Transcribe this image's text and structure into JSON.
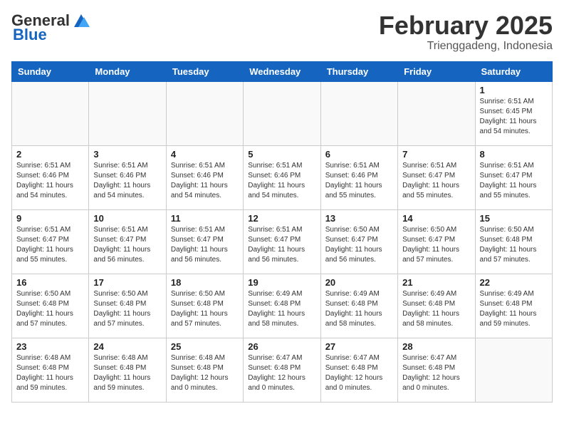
{
  "logo": {
    "text_general": "General",
    "text_blue": "Blue"
  },
  "header": {
    "month": "February 2025",
    "location": "Trienggadeng, Indonesia"
  },
  "weekdays": [
    "Sunday",
    "Monday",
    "Tuesday",
    "Wednesday",
    "Thursday",
    "Friday",
    "Saturday"
  ],
  "weeks": [
    [
      {
        "day": "",
        "info": ""
      },
      {
        "day": "",
        "info": ""
      },
      {
        "day": "",
        "info": ""
      },
      {
        "day": "",
        "info": ""
      },
      {
        "day": "",
        "info": ""
      },
      {
        "day": "",
        "info": ""
      },
      {
        "day": "1",
        "info": "Sunrise: 6:51 AM\nSunset: 6:45 PM\nDaylight: 11 hours\nand 54 minutes."
      }
    ],
    [
      {
        "day": "2",
        "info": "Sunrise: 6:51 AM\nSunset: 6:46 PM\nDaylight: 11 hours\nand 54 minutes."
      },
      {
        "day": "3",
        "info": "Sunrise: 6:51 AM\nSunset: 6:46 PM\nDaylight: 11 hours\nand 54 minutes."
      },
      {
        "day": "4",
        "info": "Sunrise: 6:51 AM\nSunset: 6:46 PM\nDaylight: 11 hours\nand 54 minutes."
      },
      {
        "day": "5",
        "info": "Sunrise: 6:51 AM\nSunset: 6:46 PM\nDaylight: 11 hours\nand 54 minutes."
      },
      {
        "day": "6",
        "info": "Sunrise: 6:51 AM\nSunset: 6:46 PM\nDaylight: 11 hours\nand 55 minutes."
      },
      {
        "day": "7",
        "info": "Sunrise: 6:51 AM\nSunset: 6:47 PM\nDaylight: 11 hours\nand 55 minutes."
      },
      {
        "day": "8",
        "info": "Sunrise: 6:51 AM\nSunset: 6:47 PM\nDaylight: 11 hours\nand 55 minutes."
      }
    ],
    [
      {
        "day": "9",
        "info": "Sunrise: 6:51 AM\nSunset: 6:47 PM\nDaylight: 11 hours\nand 55 minutes."
      },
      {
        "day": "10",
        "info": "Sunrise: 6:51 AM\nSunset: 6:47 PM\nDaylight: 11 hours\nand 56 minutes."
      },
      {
        "day": "11",
        "info": "Sunrise: 6:51 AM\nSunset: 6:47 PM\nDaylight: 11 hours\nand 56 minutes."
      },
      {
        "day": "12",
        "info": "Sunrise: 6:51 AM\nSunset: 6:47 PM\nDaylight: 11 hours\nand 56 minutes."
      },
      {
        "day": "13",
        "info": "Sunrise: 6:50 AM\nSunset: 6:47 PM\nDaylight: 11 hours\nand 56 minutes."
      },
      {
        "day": "14",
        "info": "Sunrise: 6:50 AM\nSunset: 6:47 PM\nDaylight: 11 hours\nand 57 minutes."
      },
      {
        "day": "15",
        "info": "Sunrise: 6:50 AM\nSunset: 6:48 PM\nDaylight: 11 hours\nand 57 minutes."
      }
    ],
    [
      {
        "day": "16",
        "info": "Sunrise: 6:50 AM\nSunset: 6:48 PM\nDaylight: 11 hours\nand 57 minutes."
      },
      {
        "day": "17",
        "info": "Sunrise: 6:50 AM\nSunset: 6:48 PM\nDaylight: 11 hours\nand 57 minutes."
      },
      {
        "day": "18",
        "info": "Sunrise: 6:50 AM\nSunset: 6:48 PM\nDaylight: 11 hours\nand 57 minutes."
      },
      {
        "day": "19",
        "info": "Sunrise: 6:49 AM\nSunset: 6:48 PM\nDaylight: 11 hours\nand 58 minutes."
      },
      {
        "day": "20",
        "info": "Sunrise: 6:49 AM\nSunset: 6:48 PM\nDaylight: 11 hours\nand 58 minutes."
      },
      {
        "day": "21",
        "info": "Sunrise: 6:49 AM\nSunset: 6:48 PM\nDaylight: 11 hours\nand 58 minutes."
      },
      {
        "day": "22",
        "info": "Sunrise: 6:49 AM\nSunset: 6:48 PM\nDaylight: 11 hours\nand 59 minutes."
      }
    ],
    [
      {
        "day": "23",
        "info": "Sunrise: 6:48 AM\nSunset: 6:48 PM\nDaylight: 11 hours\nand 59 minutes."
      },
      {
        "day": "24",
        "info": "Sunrise: 6:48 AM\nSunset: 6:48 PM\nDaylight: 11 hours\nand 59 minutes."
      },
      {
        "day": "25",
        "info": "Sunrise: 6:48 AM\nSunset: 6:48 PM\nDaylight: 12 hours\nand 0 minutes."
      },
      {
        "day": "26",
        "info": "Sunrise: 6:47 AM\nSunset: 6:48 PM\nDaylight: 12 hours\nand 0 minutes."
      },
      {
        "day": "27",
        "info": "Sunrise: 6:47 AM\nSunset: 6:48 PM\nDaylight: 12 hours\nand 0 minutes."
      },
      {
        "day": "28",
        "info": "Sunrise: 6:47 AM\nSunset: 6:48 PM\nDaylight: 12 hours\nand 0 minutes."
      },
      {
        "day": "",
        "info": ""
      }
    ]
  ]
}
